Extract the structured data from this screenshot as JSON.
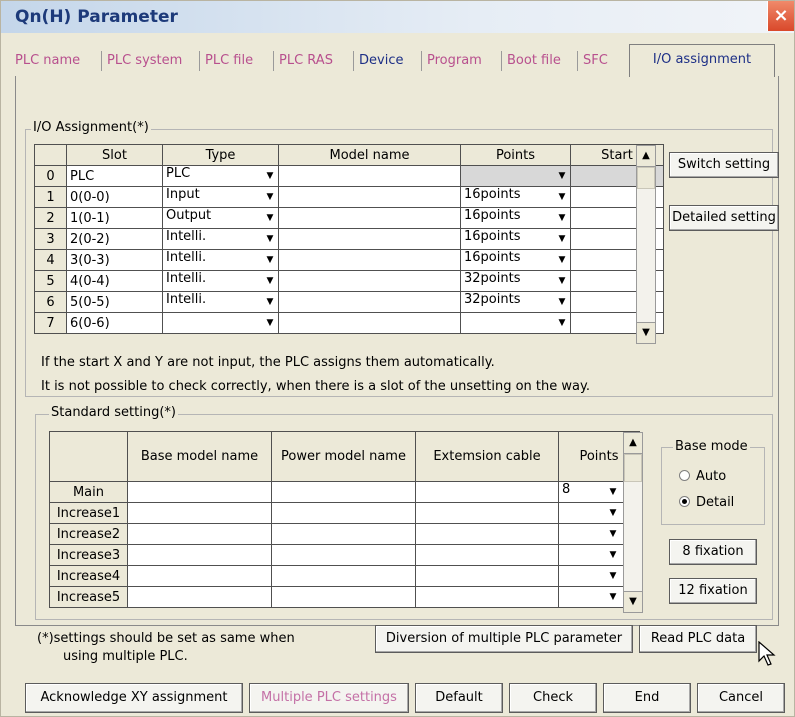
{
  "window": {
    "title": "Qn(H) Parameter",
    "close_glyph": "×"
  },
  "tabs": [
    "PLC name",
    "PLC system",
    "PLC file",
    "PLC RAS",
    "Device",
    "Program",
    "Boot file",
    "SFC",
    "I/O assignment"
  ],
  "io_assignment": {
    "label": "I/O Assignment(*)",
    "columns": [
      "Slot",
      "Type",
      "Model name",
      "Points",
      "Start"
    ],
    "rows": [
      {
        "no": "0",
        "slot": "PLC",
        "type": "PLC",
        "model": "",
        "points": "",
        "start": ""
      },
      {
        "no": "1",
        "slot": "0(0-0)",
        "type": "Input",
        "model": "",
        "points": "16points",
        "start": ""
      },
      {
        "no": "2",
        "slot": "1(0-1)",
        "type": "Output",
        "model": "",
        "points": "16points",
        "start": ""
      },
      {
        "no": "3",
        "slot": "2(0-2)",
        "type": "Intelli.",
        "model": "",
        "points": "16points",
        "start": ""
      },
      {
        "no": "4",
        "slot": "3(0-3)",
        "type": "Intelli.",
        "model": "",
        "points": "16points",
        "start": ""
      },
      {
        "no": "5",
        "slot": "4(0-4)",
        "type": "Intelli.",
        "model": "",
        "points": "32points",
        "start": ""
      },
      {
        "no": "6",
        "slot": "5(0-5)",
        "type": "Intelli.",
        "model": "",
        "points": "32points",
        "start": ""
      },
      {
        "no": "7",
        "slot": "6(0-6)",
        "type": "",
        "model": "",
        "points": "",
        "start": ""
      }
    ],
    "switch_setting_label": "Switch setting",
    "detailed_setting_label": "Detailed setting"
  },
  "notes": {
    "line1": "If the start X and Y are not input, the PLC assigns them automatically.",
    "line2": "It is not possible to check correctly, when there is a slot of the unsetting on the way."
  },
  "standard_setting": {
    "label": "Standard setting(*)",
    "columns": [
      "Base model name",
      "Power model name",
      "Extemsion cable",
      "Points"
    ],
    "rows": [
      {
        "name": "Main",
        "points": "8"
      },
      {
        "name": "Increase1",
        "points": ""
      },
      {
        "name": "Increase2",
        "points": ""
      },
      {
        "name": "Increase3",
        "points": ""
      },
      {
        "name": "Increase4",
        "points": ""
      },
      {
        "name": "Increase5",
        "points": ""
      }
    ],
    "base_mode": {
      "label": "Base mode",
      "auto": "Auto",
      "detail": "Detail",
      "selected": "Detail"
    },
    "fixation8_label": "8 fixation",
    "fixation12_label": "12 fixation"
  },
  "footnote": {
    "line1": "(*)settings should be set as same when",
    "line2": "using multiple PLC."
  },
  "buttons": {
    "diversion": "Diversion of multiple PLC parameter",
    "read_plc": "Read PLC data",
    "acknowledge": "Acknowledge XY assignment",
    "multiple_plc": "Multiple PLC settings",
    "default": "Default",
    "check": "Check",
    "end": "End",
    "cancel": "Cancel"
  },
  "icons": {
    "dropdown": "▼",
    "scroll_up": "▲",
    "scroll_down": "▼",
    "cursor": "pointer-cursor-icon"
  }
}
